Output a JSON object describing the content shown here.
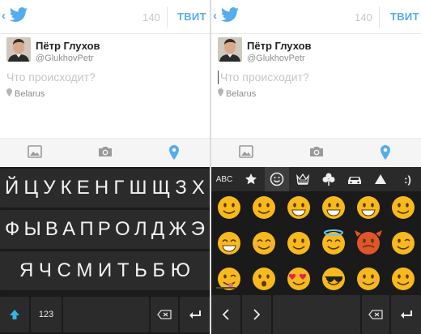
{
  "left": {
    "header": {
      "back_glyph": "‹",
      "char_count": "140",
      "tweet_label": "ТВИТ"
    },
    "user": {
      "name": "Пётр Глухов",
      "handle": "@GlukhovPetr"
    },
    "compose": {
      "placeholder": "Что происходит?",
      "location": "Belarus"
    },
    "keyboard": {
      "row1": [
        "Й",
        "Ц",
        "У",
        "К",
        "Е",
        "Н",
        "Г",
        "Ш",
        "Щ",
        "З",
        "Х"
      ],
      "row2": [
        "Ф",
        "Ы",
        "В",
        "А",
        "П",
        "Р",
        "О",
        "Л",
        "Д",
        "Ж",
        "Э"
      ],
      "row3": [
        "Я",
        "Ч",
        "С",
        "М",
        "И",
        "Т",
        "Ь",
        "Б",
        "Ю"
      ],
      "num_label": "123"
    }
  },
  "right": {
    "header": {
      "back_glyph": "‹",
      "char_count": "140",
      "tweet_label": "ТВИТ"
    },
    "user": {
      "name": "Пётр Глухов",
      "handle": "@GlukhovPetr"
    },
    "compose": {
      "placeholder": "Что происходит?",
      "location": "Belarus"
    },
    "emoji_keyboard": {
      "categories": [
        "ABC",
        "star",
        "smiley",
        "crown",
        "clover",
        "car",
        "triangle",
        ":)"
      ],
      "selected_category": "smiley",
      "emoticon_tab": ":)",
      "abc_label": "ABC",
      "emojis": [
        "face-neutral-smile",
        "face-grin",
        "face-teeth-grin",
        "face-big-grin",
        "face-laugh-teeth",
        "face-smile",
        "face-laughing",
        "face-laughing-closed",
        "face-smirk",
        "face-halo",
        "face-imp",
        "face-wink",
        "face-wink-tongue",
        "face-surprised",
        "face-heart-eyes",
        "face-sunglasses",
        "face-blushing",
        "face-smirk-side"
      ],
      "colors": {
        "emoji": "#f7b91d",
        "emoji_shade": "#e9a313",
        "mouth": "#5b3a00",
        "imp": "#e0552a"
      }
    }
  },
  "colors": {
    "twitter_blue": "#55acee",
    "keyboard_bg": "#1b1b1b",
    "key_bg": "#2b2b2b"
  }
}
